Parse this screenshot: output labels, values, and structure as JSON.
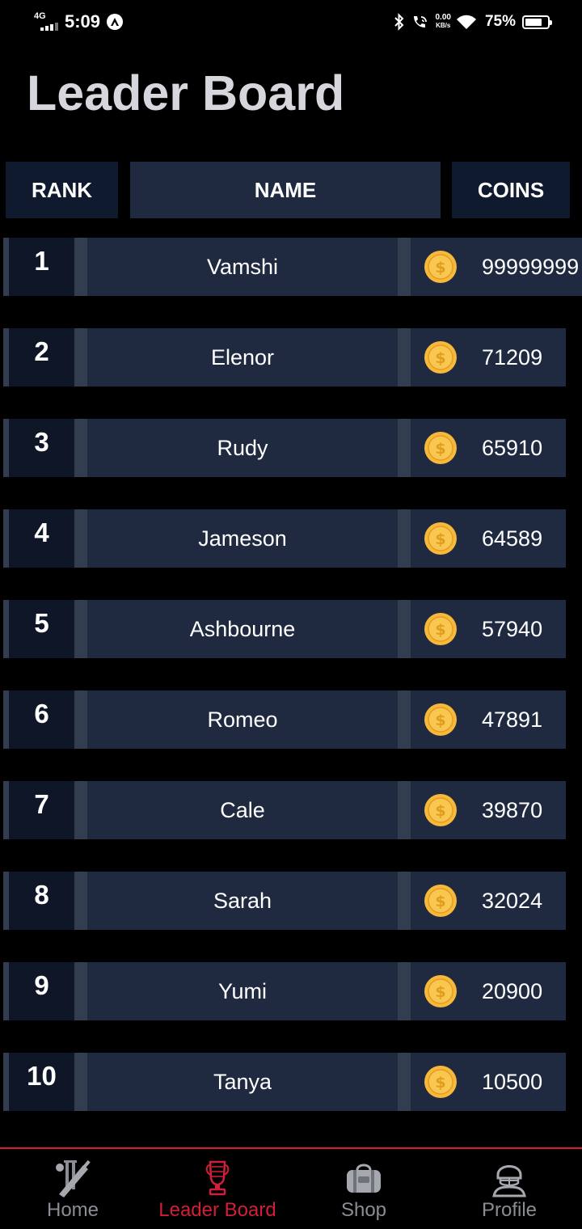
{
  "status_bar": {
    "network": "4G",
    "time": "5:09",
    "speed_value": "0.00",
    "speed_unit": "KB/s",
    "battery_percent": "75%",
    "battery_level": 0.75,
    "icons": [
      "bluetooth-icon",
      "wifi-calling-icon",
      "wifi-icon",
      "battery-icon"
    ]
  },
  "title": "Leader Board",
  "header": {
    "rank": "RANK",
    "name": "NAME",
    "coins": "COINS"
  },
  "rows": [
    {
      "rank": "1",
      "name": "Vamshi",
      "coins": "99999999"
    },
    {
      "rank": "2",
      "name": "Elenor",
      "coins": "71209"
    },
    {
      "rank": "3",
      "name": "Rudy",
      "coins": "65910"
    },
    {
      "rank": "4",
      "name": "Jameson",
      "coins": "64589"
    },
    {
      "rank": "5",
      "name": "Ashbourne",
      "coins": "57940"
    },
    {
      "rank": "6",
      "name": "Romeo",
      "coins": "47891"
    },
    {
      "rank": "7",
      "name": "Cale",
      "coins": "39870"
    },
    {
      "rank": "8",
      "name": "Sarah",
      "coins": "32024"
    },
    {
      "rank": "9",
      "name": "Yumi",
      "coins": "20900"
    },
    {
      "rank": "10",
      "name": "Tanya",
      "coins": "10500"
    }
  ],
  "nav": {
    "items": [
      {
        "label": "Home",
        "icon": "cricket-bat-icon",
        "active": false
      },
      {
        "label": "Leader Board",
        "icon": "trophy-icon",
        "active": true
      },
      {
        "label": "Shop",
        "icon": "kit-bag-icon",
        "active": false
      },
      {
        "label": "Profile",
        "icon": "helmet-player-icon",
        "active": false
      }
    ]
  },
  "colors": {
    "background": "#000000",
    "title": "#d6d7dd",
    "row": "#1f2a40",
    "rank_cell": "#0f1628",
    "accent": "#d21f37",
    "coin": "#f6b93b",
    "nav_inactive": "#8a8d94"
  }
}
